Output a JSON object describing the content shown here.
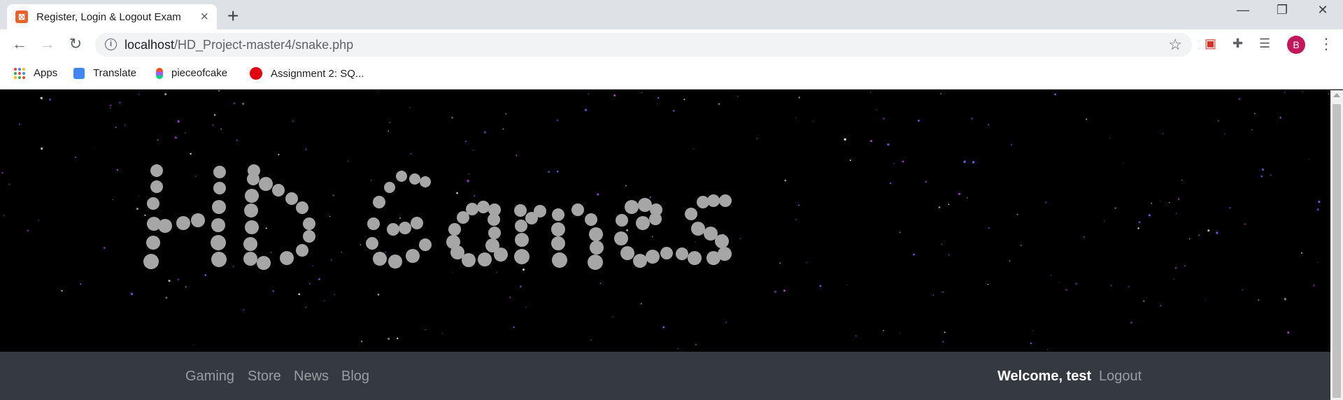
{
  "browser": {
    "tab_title": "Register, Login & Logout Exam",
    "url_host": "localhost",
    "url_path": "/HD_Project-master4/snake.php",
    "avatar_letter": "B",
    "bookmarks": [
      {
        "label": "Apps",
        "icon": "apps-grid-icon"
      },
      {
        "label": "Translate",
        "icon": "translate-icon"
      },
      {
        "label": "pieceofcake",
        "icon": "figma-icon"
      },
      {
        "label": "Assignment 2: SQ...",
        "icon": "record-icon"
      }
    ]
  },
  "hero": {
    "title": "HD Games",
    "dot_color": "#a6a6a6",
    "star_colors": [
      "#ffffff",
      "#6b6bff",
      "#c44dff"
    ]
  },
  "navbar": {
    "links": [
      "Gaming",
      "Store",
      "News",
      "Blog"
    ],
    "welcome": "Welcome, test",
    "logout": "Logout"
  }
}
